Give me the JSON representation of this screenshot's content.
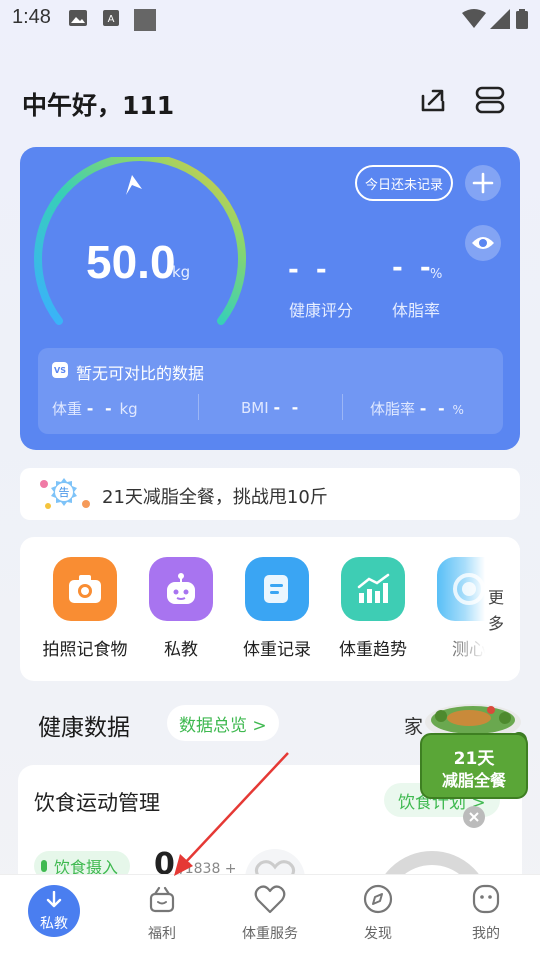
{
  "status_bar": {
    "time": "1:48"
  },
  "header": {
    "greeting": "中午好，111"
  },
  "weight_card": {
    "weight_value": "50.0",
    "weight_unit": "kg",
    "today_record_label": "今日还未记录",
    "health_score_value": "- -",
    "health_score_label": "健康评分",
    "body_fat_value": "- -",
    "body_fat_unit": "%",
    "body_fat_label": "体脂率",
    "compare": {
      "badge": "VS",
      "title": "暂无可对比的数据",
      "weight_label": "体重",
      "weight_value": "- -",
      "weight_unit": "kg",
      "bmi_label": "BMI",
      "bmi_value": "- -",
      "fat_label": "体脂率",
      "fat_value": "- -",
      "fat_unit": "%"
    }
  },
  "banner": {
    "badge": "告",
    "text": "21天减脂全餐，挑战甩10斤"
  },
  "tools": {
    "items": [
      {
        "label": "拍照记食物",
        "icon": "camera-icon",
        "color": "#f98d33"
      },
      {
        "label": "私教",
        "icon": "robot-icon",
        "color": "#a874f0"
      },
      {
        "label": "体重记录",
        "icon": "record-icon",
        "color": "#3aa5f3"
      },
      {
        "label": "体重趋势",
        "icon": "trend-chart-icon",
        "color": "#3ecdb4"
      },
      {
        "label": "测心",
        "icon": "measure-icon",
        "color": "#3fb5f5"
      }
    ],
    "more_label": "更多"
  },
  "health": {
    "title": "健康数据",
    "overview_label": "数据总览 >",
    "home_label": "家"
  },
  "diet": {
    "title": "饮食运动管理",
    "plan_label": "饮食计划 >",
    "intake_label": "饮食摄入",
    "intake_value": "0",
    "intake_sub": "/1838 +"
  },
  "promo": {
    "line1": "21天",
    "line2": "减脂全餐"
  },
  "bottom_nav": {
    "items": [
      {
        "label": "私教",
        "icon": "download-arrow-icon"
      },
      {
        "label": "福利",
        "icon": "gift-icon"
      },
      {
        "label": "体重服务",
        "icon": "heart-icon"
      },
      {
        "label": "发现",
        "icon": "compass-icon"
      },
      {
        "label": "我的",
        "icon": "profile-icon"
      }
    ]
  },
  "colors": {
    "primary": "#5a86f1",
    "green": "#3fb950",
    "nav_active": "#4a7ef0"
  }
}
